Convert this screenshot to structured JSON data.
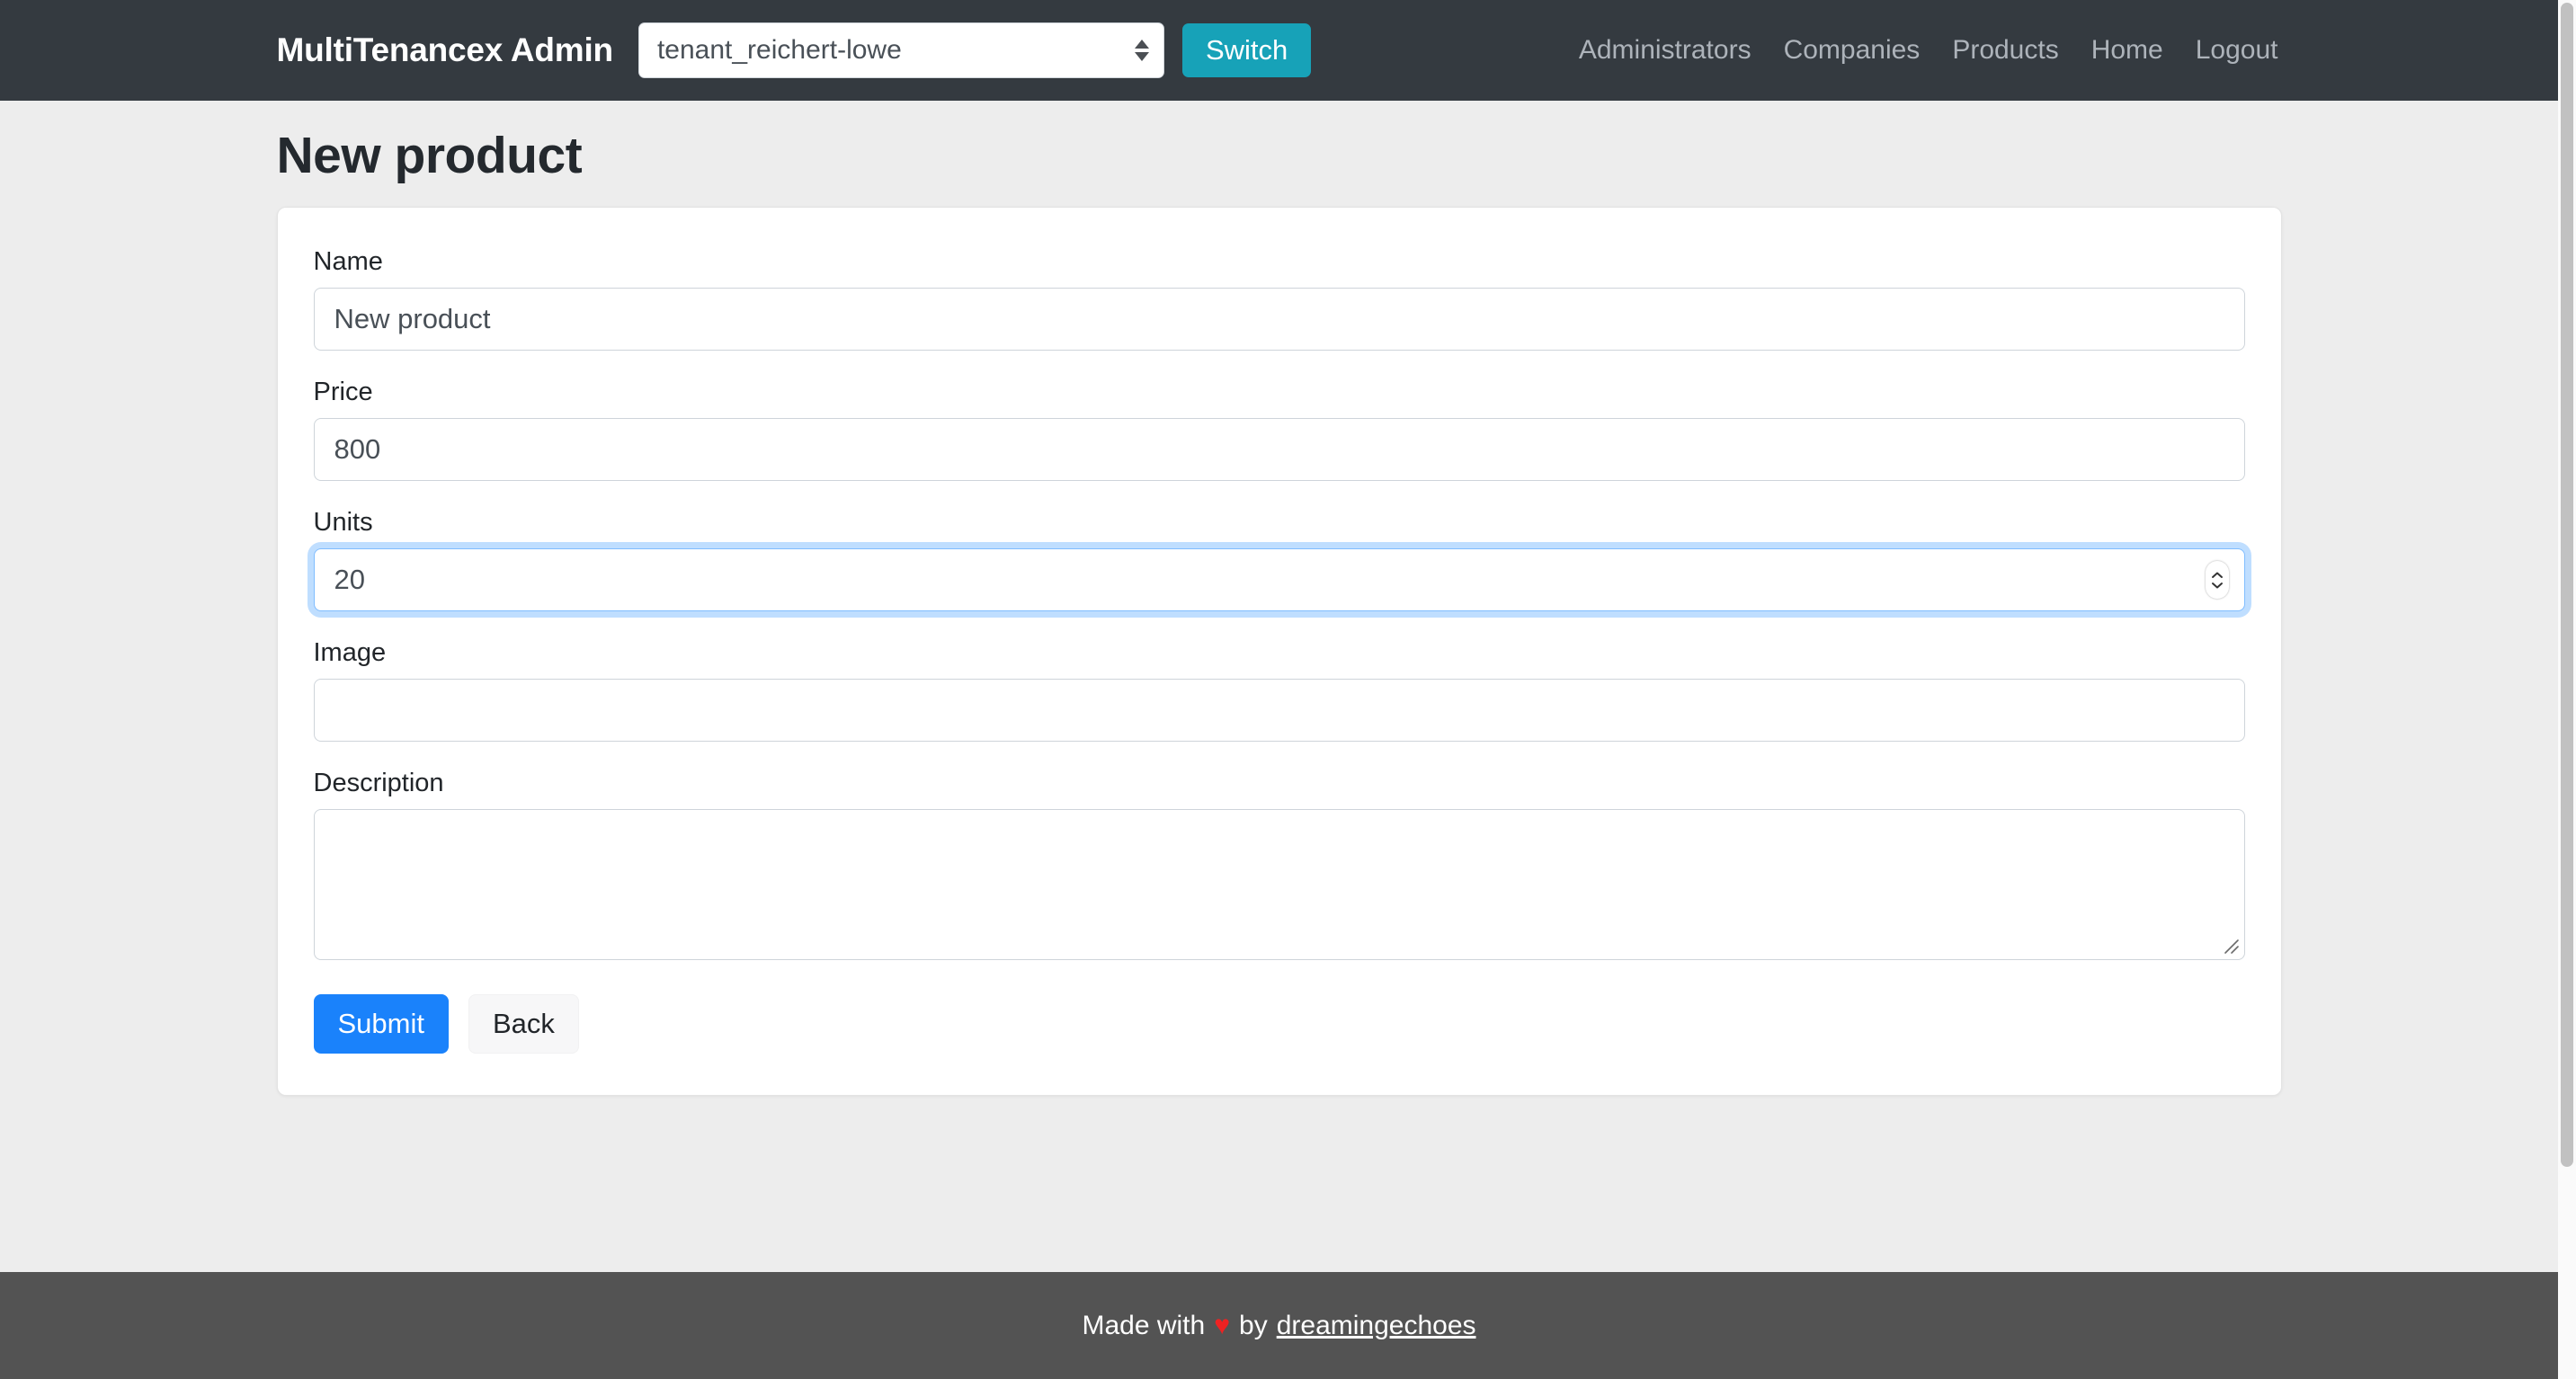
{
  "navbar": {
    "brand": "MultiTenancex Admin",
    "tenant_select": {
      "value": "tenant_reichert-lowe",
      "icon": "select-arrows-icon"
    },
    "switch_button": "Switch",
    "links": [
      {
        "label": "Administrators"
      },
      {
        "label": "Companies"
      },
      {
        "label": "Products"
      },
      {
        "label": "Home"
      },
      {
        "label": "Logout"
      }
    ]
  },
  "main": {
    "page_title": "New product",
    "form": {
      "name": {
        "label": "Name",
        "value": "New product",
        "placeholder": ""
      },
      "price": {
        "label": "Price",
        "value": "800",
        "placeholder": ""
      },
      "units": {
        "label": "Units",
        "value": "20",
        "placeholder": "",
        "focused": true
      },
      "image": {
        "label": "Image",
        "value": "",
        "placeholder": ""
      },
      "description": {
        "label": "Description",
        "value": "",
        "placeholder": ""
      }
    },
    "buttons": {
      "submit": "Submit",
      "back": "Back"
    }
  },
  "footer": {
    "prefix": "Made with",
    "heart": "♥",
    "middle": "by",
    "link": "dreamingechoes"
  },
  "colors": {
    "navbar_bg": "#343a40",
    "page_bg": "#ededed",
    "switch_btn": "#17a2b8",
    "submit_btn": "#1a82fb",
    "footer_bg": "#535353",
    "heart": "#ee2222",
    "focus_ring": "#80bdff"
  }
}
